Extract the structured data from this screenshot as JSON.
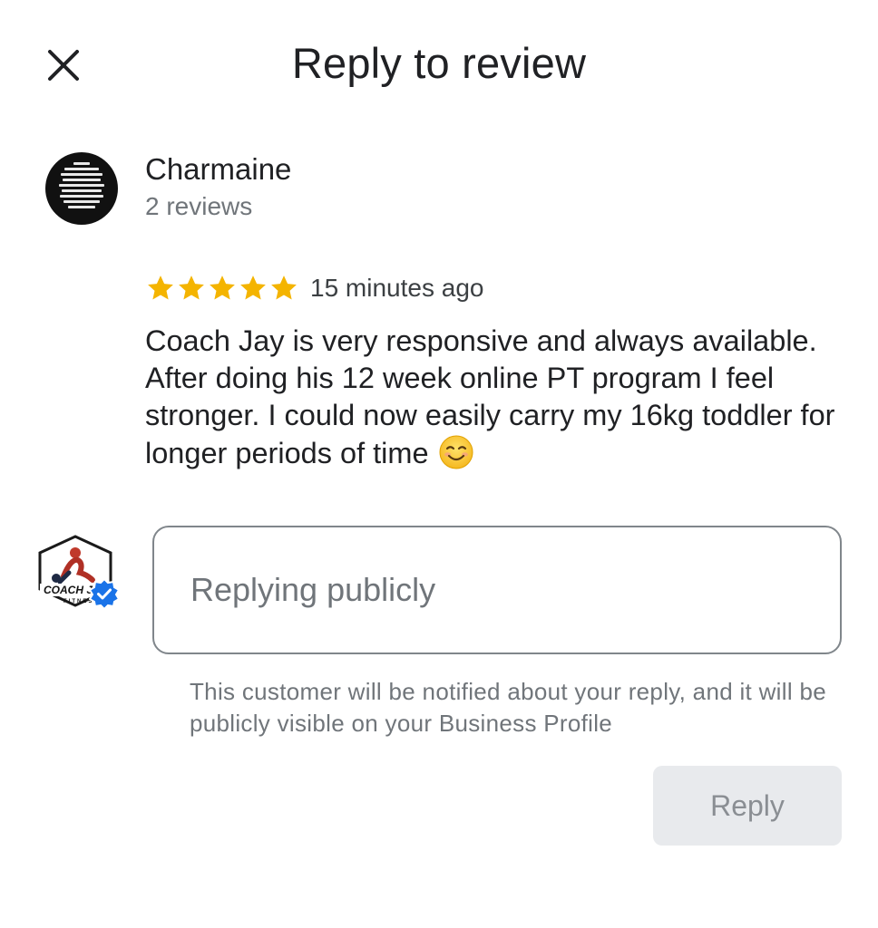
{
  "header": {
    "title": "Reply to review",
    "close_icon": "close-icon"
  },
  "review": {
    "reviewer_name": "Charmaine",
    "reviewer_meta": "2 reviews",
    "rating": 5,
    "rating_max": 5,
    "star_color": "#F4B400",
    "time_ago": "15 minutes ago",
    "text": "Coach Jay is very responsive and always available. After doing his 12 week online PT program I feel stronger. I could now easily carry my 16kg toddler for longer periods of time",
    "emoji_icon": "smiling-face-emoji"
  },
  "business": {
    "logo_text": "COACH J",
    "logo_subtext": "FITNESS",
    "verified_icon": "verified-badge-icon",
    "verified_color": "#1A73E8"
  },
  "reply": {
    "input_value": "",
    "input_placeholder": "Replying publicly",
    "notice": "This customer will be notified about your reply, and it will be publicly visible on your Business Profile",
    "button_label": "Reply",
    "button_enabled": false
  }
}
